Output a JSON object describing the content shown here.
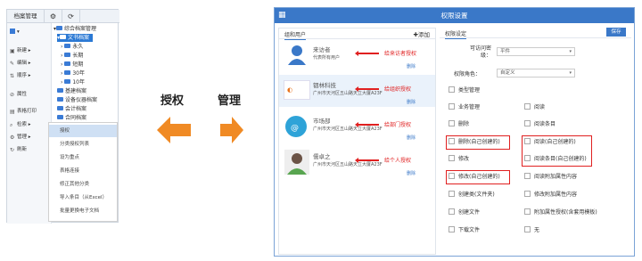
{
  "left_panel": {
    "tabs": [
      "档案管理"
    ],
    "sidebar": [
      {
        "label": "新建",
        "icon": "new-icon"
      },
      {
        "label": "编辑",
        "icon": "edit-icon"
      },
      {
        "label": "顺序",
        "icon": "sort-icon"
      },
      {
        "label": "属性",
        "icon": "property-icon"
      },
      {
        "label": "表格打印",
        "icon": "print-icon"
      },
      {
        "label": "检索",
        "icon": "search-icon"
      },
      {
        "label": "管理",
        "icon": "manage-icon"
      },
      {
        "label": "刷新",
        "icon": "refresh-icon"
      }
    ],
    "tree": [
      {
        "label": "综合档案管理",
        "level": 0,
        "selected": false
      },
      {
        "label": "文书档案",
        "level": 1,
        "selected": true
      },
      {
        "label": "永久",
        "level": 2,
        "selected": false
      },
      {
        "label": "长期",
        "level": 2,
        "selected": false
      },
      {
        "label": "短期",
        "level": 2,
        "selected": false
      },
      {
        "label": "30年",
        "level": 2,
        "selected": false
      },
      {
        "label": "10年",
        "level": 2,
        "selected": false
      },
      {
        "label": "基建档案",
        "level": 1,
        "selected": false
      },
      {
        "label": "设备仪器档案",
        "level": 1,
        "selected": false
      },
      {
        "label": "会计档案",
        "level": 1,
        "selected": false
      },
      {
        "label": "合同档案",
        "level": 1,
        "selected": false
      }
    ],
    "context_menu": [
      {
        "label": "授权",
        "highlighted": true
      },
      {
        "label": "分类授权列表",
        "highlighted": false
      },
      {
        "label": "设为重点",
        "highlighted": false
      },
      {
        "label": "表格连接",
        "highlighted": false
      },
      {
        "label": "修正其他分类",
        "highlighted": false
      },
      {
        "label": "导入条目（从Excel）",
        "highlighted": false
      },
      {
        "label": "批量更换电子文档",
        "highlighted": false
      }
    ]
  },
  "arrows": {
    "left_label": "授权",
    "right_label": "管理",
    "color": "#f08a24"
  },
  "dialog": {
    "title": "权限设置",
    "left_tab": "组和用户",
    "add_label": "✚添加",
    "entries": [
      {
        "name": "来访者",
        "desc": "代表所有用户",
        "delete": "删除",
        "note": "给来访者授权",
        "avatar": "visitor-avatar"
      },
      {
        "name": "铟林科技",
        "desc": "广州市天河区五山路天立大厦A23F",
        "delete": "删除",
        "note": "给组织授权",
        "avatar": "org-logo"
      },
      {
        "name": "市场部",
        "desc": "广州市天河区五山路天立大厦A23F",
        "delete": "删除",
        "note": "给部门授权",
        "avatar": "department-icon"
      },
      {
        "name": "儒卓之",
        "desc": "广州市天河区五山路天立大厦A23F",
        "delete": "删除",
        "note": "给个人授权",
        "avatar": "person-avatar"
      }
    ],
    "right_tab": "权限设定",
    "save_label": "保存",
    "visibility_label": "可访问密级：",
    "visibility_value": "平件",
    "role_label": "权限角色：",
    "role_value": "自定义",
    "permissions": [
      {
        "label": "类型管理"
      },
      {
        "label": "业务管理"
      },
      {
        "label": "阅读"
      },
      {
        "label": "删除"
      },
      {
        "label": "阅读条目"
      },
      {
        "label": "删除(自己创建的)"
      },
      {
        "label": "阅读(自己创建的)"
      },
      {
        "label": "修改"
      },
      {
        "label": "阅读条目(自己创建的)"
      },
      {
        "label": "修改(自己创建的)"
      },
      {
        "label": "阅读附加属性内容"
      },
      {
        "label": "创建类(文件夹)"
      },
      {
        "label": "修改附加属性内容"
      },
      {
        "label": "创建文件"
      },
      {
        "label": "附加属性授权(含套用模板)"
      },
      {
        "label": "下载文件"
      },
      {
        "label": "无"
      }
    ],
    "note_color": "#e02020",
    "header_color": "#3a78c8"
  }
}
